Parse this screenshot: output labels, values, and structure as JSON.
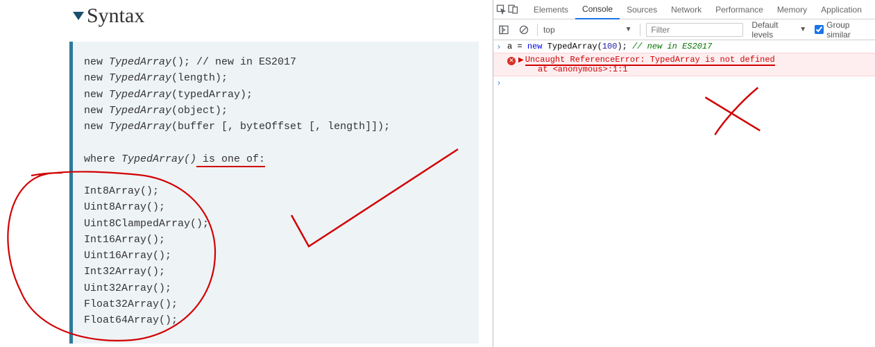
{
  "heading": "Syntax",
  "code": {
    "constructors": [
      {
        "prefix": "new ",
        "type": "TypedArray",
        "args": "(); // new in ES2017"
      },
      {
        "prefix": "new ",
        "type": "TypedArray",
        "args": "(length);"
      },
      {
        "prefix": "new ",
        "type": "TypedArray",
        "args": "(typedArray);"
      },
      {
        "prefix": "new ",
        "type": "TypedArray",
        "args": "(object);"
      },
      {
        "prefix": "new ",
        "type": "TypedArray",
        "args": "(buffer [, byteOffset [, length]]);"
      }
    ],
    "where_prefix": "where ",
    "where_type": "TypedArray()",
    "where_suffix_underlined": " is one of:",
    "types": [
      "Int8Array();",
      "Uint8Array();",
      "Uint8ClampedArray();",
      "Int16Array();",
      "Uint16Array();",
      "Int32Array();",
      "Uint32Array();",
      "Float32Array();",
      "Float64Array();"
    ]
  },
  "devtools": {
    "tabs": [
      "Elements",
      "Console",
      "Sources",
      "Network",
      "Performance",
      "Memory",
      "Application"
    ],
    "active_tab_index": 1,
    "more_icon": "»",
    "context": "top",
    "filter_placeholder": "Filter",
    "levels_label": "Default levels",
    "group_label": "Group similar",
    "input_line": {
      "assign": "a = ",
      "kw_new": "new",
      "rest": " TypedArray(",
      "num": "100",
      "rest2": "); ",
      "comment": "// new in ES2017"
    },
    "error": {
      "line1": "Uncaught ReferenceError: TypedArray is not defined",
      "line2": "at <anonymous>:1:1"
    }
  }
}
